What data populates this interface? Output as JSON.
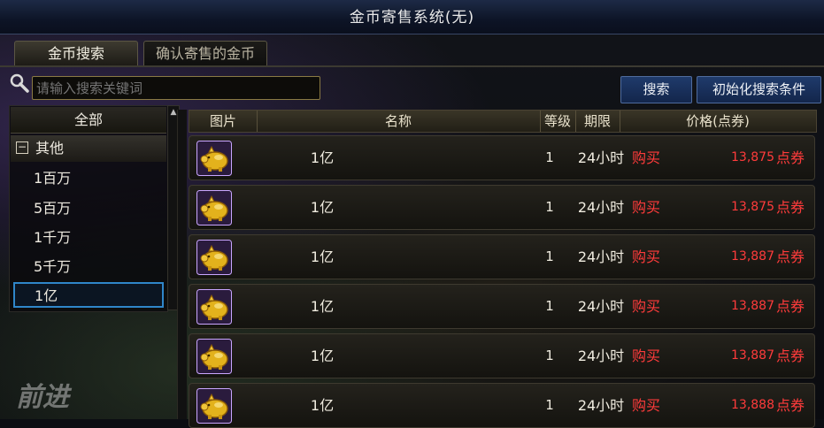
{
  "window": {
    "title": "金币寄售系统(无)"
  },
  "tabs": [
    {
      "label": "金币搜索",
      "active": true
    },
    {
      "label": "确认寄售的金币",
      "active": false
    }
  ],
  "search": {
    "placeholder": "请输入搜索关键词",
    "value": ""
  },
  "buttons": {
    "search": "搜索",
    "reset": "初始化搜索条件"
  },
  "categories": {
    "all": "全部",
    "group": {
      "toggle": "日",
      "label": "其他"
    },
    "items": [
      "1百万",
      "5百万",
      "1千万",
      "5千万",
      "1亿"
    ],
    "selected": "1亿"
  },
  "table": {
    "headers": {
      "image": "图片",
      "name": "名称",
      "level": "等级",
      "expiry": "期限",
      "price": "价格(点券)"
    },
    "rows": [
      {
        "name": "1亿",
        "level": "1",
        "expiry": "24小时",
        "action": "购买",
        "price": "13,875",
        "unit": "点券"
      },
      {
        "name": "1亿",
        "level": "1",
        "expiry": "24小时",
        "action": "购买",
        "price": "13,875",
        "unit": "点券"
      },
      {
        "name": "1亿",
        "level": "1",
        "expiry": "24小时",
        "action": "购买",
        "price": "13,887",
        "unit": "点券"
      },
      {
        "name": "1亿",
        "level": "1",
        "expiry": "24小时",
        "action": "购买",
        "price": "13,887",
        "unit": "点券"
      },
      {
        "name": "1亿",
        "level": "1",
        "expiry": "24小时",
        "action": "购买",
        "price": "13,887",
        "unit": "点券"
      },
      {
        "name": "1亿",
        "level": "1",
        "expiry": "24小时",
        "action": "购买",
        "price": "13,888",
        "unit": "点券"
      }
    ]
  },
  "background": {
    "forward_label": "前进"
  },
  "colors": {
    "price_red": "#ff3b3b",
    "button_blue": "#1f3a6b",
    "selected_border": "#2f86c9"
  },
  "icons": {
    "search": "magnifier-icon",
    "item": "gold-pig-icon"
  }
}
